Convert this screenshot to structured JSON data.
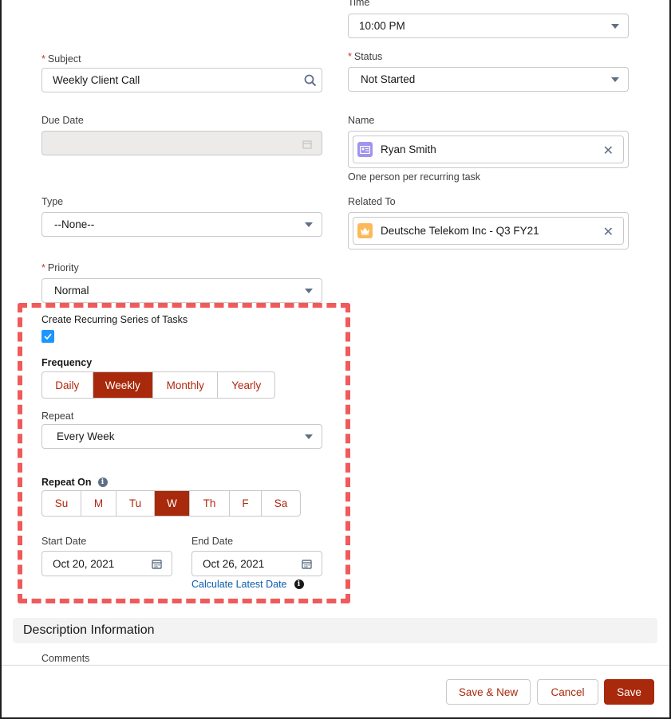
{
  "time": {
    "label": "Time",
    "value": "10:00 PM"
  },
  "subject": {
    "label": "Subject",
    "value": "Weekly Client Call",
    "icon": "search-icon"
  },
  "status": {
    "label": "Status",
    "value": "Not Started"
  },
  "due_date": {
    "label": "Due Date",
    "value": ""
  },
  "name": {
    "label": "Name",
    "value": "Ryan Smith",
    "help": "One person per recurring task",
    "icon_color": "#a094ed"
  },
  "type": {
    "label": "Type",
    "value": "--None--"
  },
  "related_to": {
    "label": "Related To",
    "value": "Deutsche Telekom Inc - Q3 FY21",
    "icon_color": "#fcb95b"
  },
  "priority": {
    "label": "Priority",
    "value": "Normal"
  },
  "recurring": {
    "checkbox_label": "Create Recurring Series of Tasks",
    "checked": true,
    "frequency_label": "Frequency",
    "frequency_options": [
      "Daily",
      "Weekly",
      "Monthly",
      "Yearly"
    ],
    "frequency_selected": "Weekly",
    "repeat_label": "Repeat",
    "repeat_value": "Every Week",
    "repeat_on_label": "Repeat On",
    "days": [
      "Su",
      "M",
      "Tu",
      "W",
      "Th",
      "F",
      "Sa"
    ],
    "day_selected": "W",
    "start_date_label": "Start Date",
    "start_date": "Oct 20, 2021",
    "end_date_label": "End Date",
    "end_date": "Oct 26, 2021",
    "calculate_link": "Calculate Latest Date"
  },
  "description": {
    "section_title": "Description Information",
    "comments_label": "Comments"
  },
  "footer": {
    "save_new": "Save & New",
    "cancel": "Cancel",
    "save": "Save"
  },
  "colors": {
    "brand": "#a8290b",
    "highlight": "#f05a5a",
    "link": "#0b5cab"
  }
}
